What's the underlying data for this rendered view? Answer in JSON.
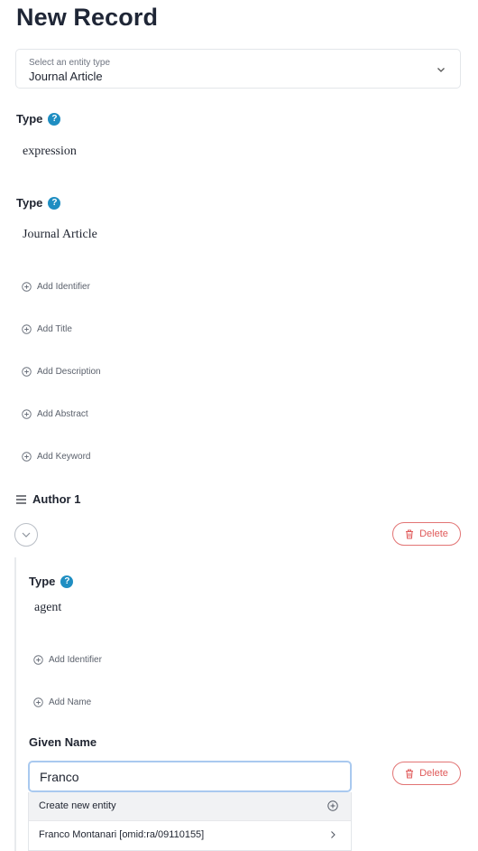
{
  "page": {
    "title": "New Record"
  },
  "entity_select": {
    "placeholder": "Select an entity type",
    "value": "Journal Article"
  },
  "record": {
    "type_label_1": "Type",
    "type_value_1": "expression",
    "type_label_2": "Type",
    "type_value_2": "Journal Article",
    "help_glyph": "?",
    "add_links": [
      "Add Identifier",
      "Add Title",
      "Add Description",
      "Add Abstract",
      "Add Keyword"
    ]
  },
  "author": {
    "header": "Author 1",
    "delete_label": "Delete",
    "type_label": "Type",
    "type_value": "agent",
    "add_links": [
      "Add Identifier",
      "Add Name"
    ],
    "given_name_label": "Given Name",
    "given_name_value": "Franco",
    "given_name_delete_label": "Delete"
  },
  "suggestions": {
    "create_label": "Create new entity",
    "items": [
      "Franco Montanari [omid:ra/09110155]"
    ]
  },
  "icons": {
    "help": "help-circle-icon",
    "chevron": "chevron-down-icon",
    "add": "plus-circle-icon",
    "drag": "drag-handle-icon",
    "trash": "trash-icon",
    "arrow": "chevron-right-icon"
  },
  "colors": {
    "help_blue": "#1f8ec2",
    "delete_red": "#e05a5a",
    "focus_border": "#a9c9ef"
  }
}
